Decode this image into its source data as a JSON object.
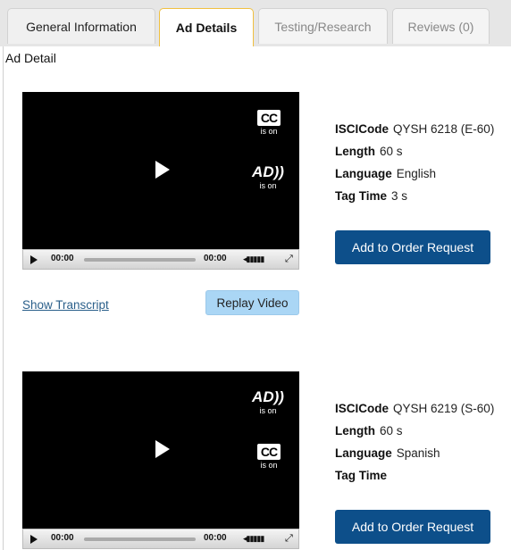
{
  "tabs": [
    {
      "label": "General Information"
    },
    {
      "label": "Ad Details"
    },
    {
      "label": "Testing/Research"
    },
    {
      "label": "Reviews (0)"
    }
  ],
  "active_tab": "Ad Details",
  "section_title": "Ad Detail",
  "ads": [
    {
      "badges": [
        {
          "icon": "closed-caption-icon",
          "logo": "CC",
          "status": "is on"
        },
        {
          "icon": "audio-description-icon",
          "logo": "AD",
          "status": "is on"
        }
      ],
      "player": {
        "current_time": "00:00",
        "duration": "00:00"
      },
      "fields": [
        {
          "key": "ISCICode",
          "value": "QYSH 6218 (E-60)"
        },
        {
          "key": "Length",
          "value": "60 s"
        },
        {
          "key": "Language",
          "value": "English"
        },
        {
          "key": "Tag Time",
          "value": "3 s"
        }
      ],
      "order_button": "Add to Order Request",
      "transcript_link": "Show Transcript",
      "replay_button": "Replay Video"
    },
    {
      "badges": [
        {
          "icon": "audio-description-icon",
          "logo": "AD",
          "status": "is on"
        },
        {
          "icon": "closed-caption-icon",
          "logo": "CC",
          "status": "is on"
        }
      ],
      "player": {
        "current_time": "00:00",
        "duration": "00:00"
      },
      "fields": [
        {
          "key": "ISCICode",
          "value": "QYSH 6219 (S-60)"
        },
        {
          "key": "Length",
          "value": "60 s"
        },
        {
          "key": "Language",
          "value": "Spanish"
        },
        {
          "key": "Tag Time",
          "value": ""
        }
      ],
      "order_button": "Add to Order Request"
    }
  ]
}
